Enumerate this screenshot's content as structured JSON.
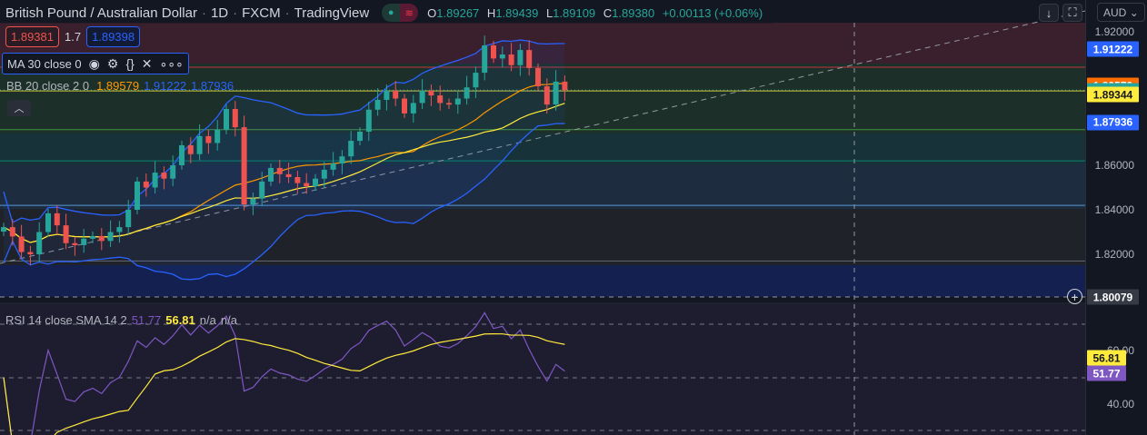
{
  "header": {
    "symbol": "British Pound / Australian Dollar",
    "interval": "1D",
    "exchange": "FXCM",
    "source": "TradingView",
    "ohlc": {
      "o_label": "O",
      "o": "1.89267",
      "h_label": "H",
      "h": "1.89439",
      "l_label": "L",
      "l": "1.89109",
      "c_label": "C",
      "c": "1.89380",
      "change": "+0.00113 (+0.06%)"
    }
  },
  "quote": {
    "sell": "1.89381",
    "spread": "1.7",
    "buy": "1.89398"
  },
  "indicators": {
    "ma": {
      "label": "MA 30 close 0"
    },
    "bb": {
      "label": "BB 20 close 2 0",
      "basis": "1.89579",
      "upper": "1.91222",
      "lower": "1.87936"
    }
  },
  "axis": {
    "currency": "AUD",
    "ticks": [
      "1.92000",
      "1.86000",
      "1.84000",
      "1.82000"
    ],
    "labels": [
      {
        "v": "1.91222",
        "price": 1.91222,
        "bg": "#2962ff",
        "fg": "#ffffff"
      },
      {
        "v": "1.89579",
        "price": 1.89579,
        "bg": "#ff6d00",
        "fg": "#ffffff"
      },
      {
        "v": "1.89380",
        "price": 1.8938,
        "bg": "#26a69a",
        "fg": "#ffffff"
      },
      {
        "v": "1.89344",
        "price": 1.89344,
        "bg": "#ffeb3b",
        "fg": "#131722"
      },
      {
        "v": "1.87936",
        "price": 1.87936,
        "bg": "#2962ff",
        "fg": "#ffffff"
      },
      {
        "v": "1.80079",
        "price": 1.80079,
        "bg": "#363a45",
        "fg": "#ffffff"
      }
    ]
  },
  "rsi": {
    "label": "RSI 14 close SMA 14 2",
    "rsi_value": "51.77",
    "sma_value": "56.81",
    "na1": "n/a",
    "na2": "n/a",
    "ticks": [
      "60.00",
      "40.00"
    ]
  },
  "colors": {
    "up": "#26a69a",
    "down": "#ef5350",
    "bb": "#2962ff",
    "basis": "#ff9800",
    "ma": "#ffeb3b",
    "rsi": "#7e57c2"
  },
  "chart_data": {
    "type": "candlestick",
    "title": "British Pound / Australian Dollar 1D",
    "ylim": [
      1.80079,
      1.925
    ],
    "closes": [
      1.8322,
      1.828,
      1.821,
      1.82,
      1.83,
      1.8384,
      1.833,
      1.825,
      1.8241,
      1.827,
      1.8282,
      1.826,
      1.83,
      1.8322,
      1.84,
      1.8527,
      1.85,
      1.8567,
      1.854,
      1.86,
      1.869,
      1.865,
      1.8731,
      1.87,
      1.876,
      1.8853,
      1.8771,
      1.8424,
      1.845,
      1.8527,
      1.8588,
      1.856,
      1.8547,
      1.852,
      1.8506,
      1.854,
      1.858,
      1.8608,
      1.864,
      1.871,
      1.8751,
      1.885,
      1.8894,
      1.8935,
      1.89,
      1.8833,
      1.888,
      1.8935,
      1.8914,
      1.888,
      1.8873,
      1.89,
      1.895,
      1.9016,
      1.9139,
      1.908,
      1.9098,
      1.905,
      1.9118,
      1.9037,
      1.8955,
      1.8873,
      1.8976,
      1.8938
    ],
    "levels": [
      1.9041,
      1.8938,
      1.8934,
      1.876,
      1.862,
      1.842,
      1.817
    ],
    "rsi_range": [
      25,
      75
    ]
  }
}
